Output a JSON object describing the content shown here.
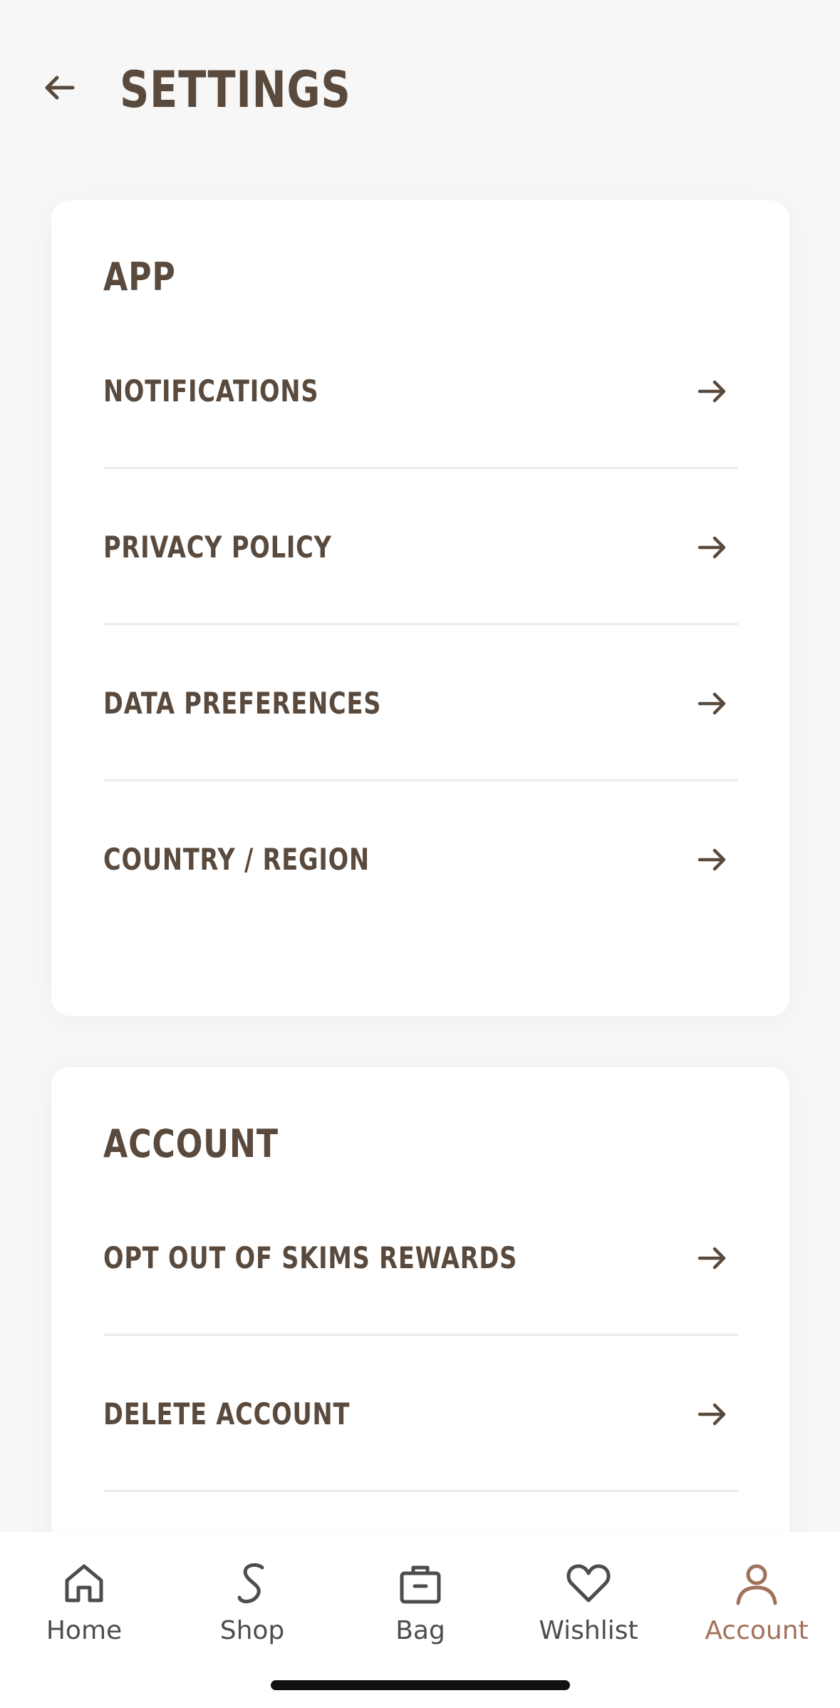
{
  "header": {
    "title": "SETTINGS",
    "back_icon": "arrow-left-icon"
  },
  "app_section": {
    "title": "APP",
    "items": [
      {
        "label": "NOTIFICATIONS",
        "icon": "arrow-right-icon"
      },
      {
        "label": "PRIVACY POLICY",
        "icon": "arrow-right-icon"
      },
      {
        "label": "DATA PREFERENCES",
        "icon": "arrow-right-icon"
      },
      {
        "label": "COUNTRY / REGION",
        "icon": "arrow-right-icon"
      }
    ]
  },
  "account_section": {
    "title": "ACCOUNT",
    "items": [
      {
        "label": "OPT OUT OF SKIMS REWARDS",
        "icon": "arrow-right-icon"
      },
      {
        "label": "DELETE ACCOUNT",
        "icon": "arrow-right-icon"
      }
    ]
  },
  "tabbar": {
    "tabs": [
      {
        "label": "Home",
        "icon": "home-icon",
        "active": false
      },
      {
        "label": "Shop",
        "icon": "shop-icon",
        "active": false
      },
      {
        "label": "Bag",
        "icon": "bag-icon",
        "active": false
      },
      {
        "label": "Wishlist",
        "icon": "heart-icon",
        "active": false
      },
      {
        "label": "Account",
        "icon": "user-icon",
        "active": true
      }
    ]
  },
  "colors": {
    "text": "#5a4a3d",
    "accent": "#a0715b",
    "background": "#f7f7f7",
    "card": "#ffffff"
  }
}
